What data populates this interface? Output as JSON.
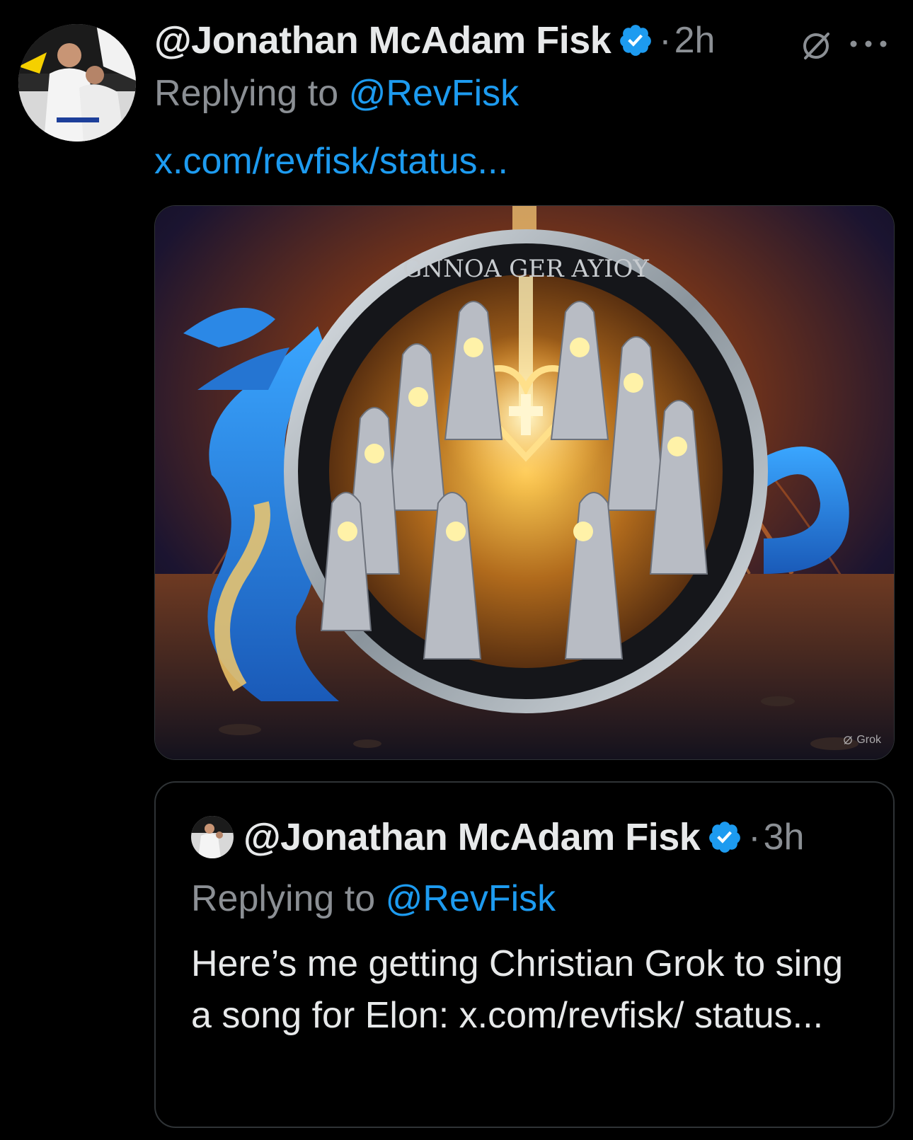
{
  "post": {
    "author_name": "@Jonathan McAdam Fisk",
    "separator": "·",
    "age": "2h",
    "replying_prefix": "Replying to ",
    "replying_handle": "@RevFisk",
    "link_text": "x.com/revfisk/status...",
    "media_watermark": "Grok",
    "media_coin_text": "GNNOA GER AYIOY"
  },
  "quoted": {
    "author_name": "@Jonathan McAdam Fisk",
    "separator": "·",
    "age": "3h",
    "replying_prefix": "Replying to ",
    "replying_handle": "@RevFisk",
    "text": "Here’s me getting Christian Grok to sing a song for Elon: x.com/revfisk/ status..."
  },
  "icons": {
    "verified": "verified-badge-icon",
    "grok": "grok-icon",
    "more": "more-options-icon"
  },
  "colors": {
    "background": "#000000",
    "link": "#1d9bf0",
    "muted": "#8b8f94",
    "verified": "#1d9bf0"
  }
}
